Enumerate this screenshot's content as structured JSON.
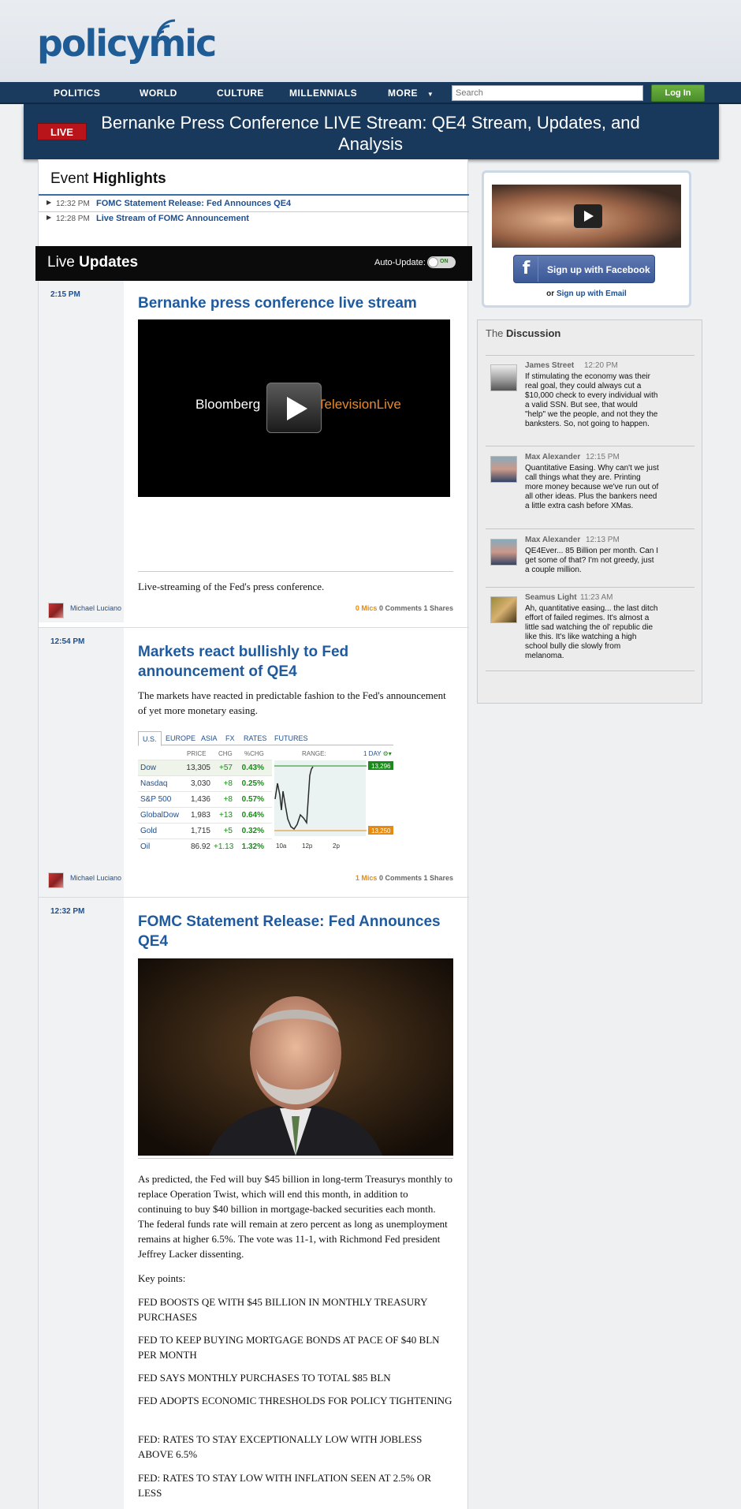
{
  "site": {
    "logo_text": "policymic"
  },
  "nav": {
    "items": [
      "POLITICS",
      "WORLD",
      "CULTURE",
      "MILLENNIALS",
      "MORE"
    ],
    "search_placeholder": "Search",
    "login_label": "Log In"
  },
  "banner": {
    "live_label": "LIVE",
    "title": "Bernanke Press Conference LIVE Stream: QE4 Stream, Updates, and Analysis"
  },
  "highlights": {
    "title_light": "Event ",
    "title_bold": "Highlights",
    "items": [
      {
        "time": "12:32 PM",
        "text": "FOMC Statement Release: Fed Announces QE4"
      },
      {
        "time": "12:28 PM",
        "text": "Live Stream of FOMC Announcement"
      }
    ]
  },
  "live_updates": {
    "title_light": "Live ",
    "title_bold": "Updates",
    "auto_update_label": "Auto-Update:",
    "toggle_state": "ON"
  },
  "entries": [
    {
      "time": "2:15 PM",
      "title": "Bernanke press conference live stream",
      "video_brand_left": "Bloomberg",
      "video_brand_right": "TelevisionLive",
      "caption": "Live-streaming of the Fed's press conference.",
      "author": "Michael Luciano",
      "mics": "0 Mics",
      "comments": "0 Comments",
      "shares": "1 Shares"
    },
    {
      "time": "12:54 PM",
      "title": "Markets react bullishly to Fed announcement of QE4",
      "text": "The markets have reacted in predictable fashion to the Fed's announcement of yet more monetary easing.",
      "author": "Michael Luciano",
      "mics": "1 Mics",
      "comments": "0 Comments",
      "shares": "1 Shares"
    },
    {
      "time": "12:32 PM",
      "title": "FOMC Statement Release: Fed Announces QE4",
      "text": "As predicted, the Fed will buy $45 billion in long-term Treasurys monthly to replace Operation Twist, which will end this month, in addition to continuing to buy $40 billion in mortgage-backed securities each month. The federal funds rate will remain at zero percent as long as unemployment remains at higher 6.5%. The vote was 11-1, with Richmond Fed president Jeffrey Lacker dissenting.",
      "key_points_label": "Key points:",
      "points": [
        "FED BOOSTS QE WITH $45 BILLION IN MONTHLY TREASURY PURCHASES",
        "FED TO KEEP BUYING MORTGAGE BONDS AT PACE OF $40 BLN PER MONTH",
        "FED SAYS MONTHLY PURCHASES TO TOTAL $85 BLN",
        "FED ADOPTS ECONOMIC THRESHOLDS FOR POLICY TIGHTENING",
        "FED: RATES TO STAY EXCEPTIONALLY LOW WITH JOBLESS ABOVE 6.5%",
        "FED: RATES TO STAY LOW WITH INFLATION SEEN AT 2.5% OR LESS"
      ]
    }
  ],
  "market": {
    "tabs": [
      "U.S.",
      "EUROPE",
      "ASIA",
      "FX",
      "RATES",
      "FUTURES"
    ],
    "headers": [
      "PRICE",
      "CHG",
      "%CHG",
      "RANGE:",
      "1 DAY"
    ],
    "rows": [
      {
        "name": "Dow",
        "price": "13,305",
        "chg": "+57",
        "pct": "0.43%"
      },
      {
        "name": "Nasdaq",
        "price": "3,030",
        "chg": "+8",
        "pct": "0.25%"
      },
      {
        "name": "S&P 500",
        "price": "1,436",
        "chg": "+8",
        "pct": "0.57%"
      },
      {
        "name": "GlobalDow",
        "price": "1,983",
        "chg": "+13",
        "pct": "0.64%"
      },
      {
        "name": "Gold",
        "price": "1,715",
        "chg": "+5",
        "pct": "0.32%"
      },
      {
        "name": "Oil",
        "price": "86.92",
        "chg": "+1.13",
        "pct": "1.32%"
      }
    ],
    "chart_high": "13,296",
    "chart_low": "13,250",
    "chart_x": [
      "10a",
      "12p",
      "2p"
    ],
    "colors": {
      "line": "#2a2a2a",
      "high": "#1a8a1a",
      "low": "#e58a12"
    }
  },
  "signup": {
    "facebook_label": "Sign up with Facebook",
    "or_label": "or ",
    "email_label": "Sign up with Email"
  },
  "discussion": {
    "title_light": "The ",
    "title_bold": "Discussion",
    "comments": [
      {
        "name": "James Street",
        "time": "12:20 PM",
        "text": "If stimulating the economy was their real goal, they could always cut a $10,000 check to every individual with a valid SSN. But see, that would \"help\" we the people, and not they the banksters. So, not going to happen."
      },
      {
        "name": "Max Alexander",
        "time": "12:15 PM",
        "text": "Quantitative Easing. Why can't we just call things what they are. Printing more money because we've run out of all other ideas. Plus the bankers need a little extra cash before XMas."
      },
      {
        "name": "Max Alexander",
        "time": "12:13 PM",
        "text": "QE4Ever... 85 Billion per month. Can I get some of that? I'm not greedy, just a couple million."
      },
      {
        "name": "Seamus Light",
        "time": "11:23 AM",
        "text": "Ah, quantitative easing... the last ditch effort of failed regimes. It's almost a little sad watching the ol' republic die like this. It's like watching a high school bully die slowly from melanoma."
      }
    ]
  }
}
